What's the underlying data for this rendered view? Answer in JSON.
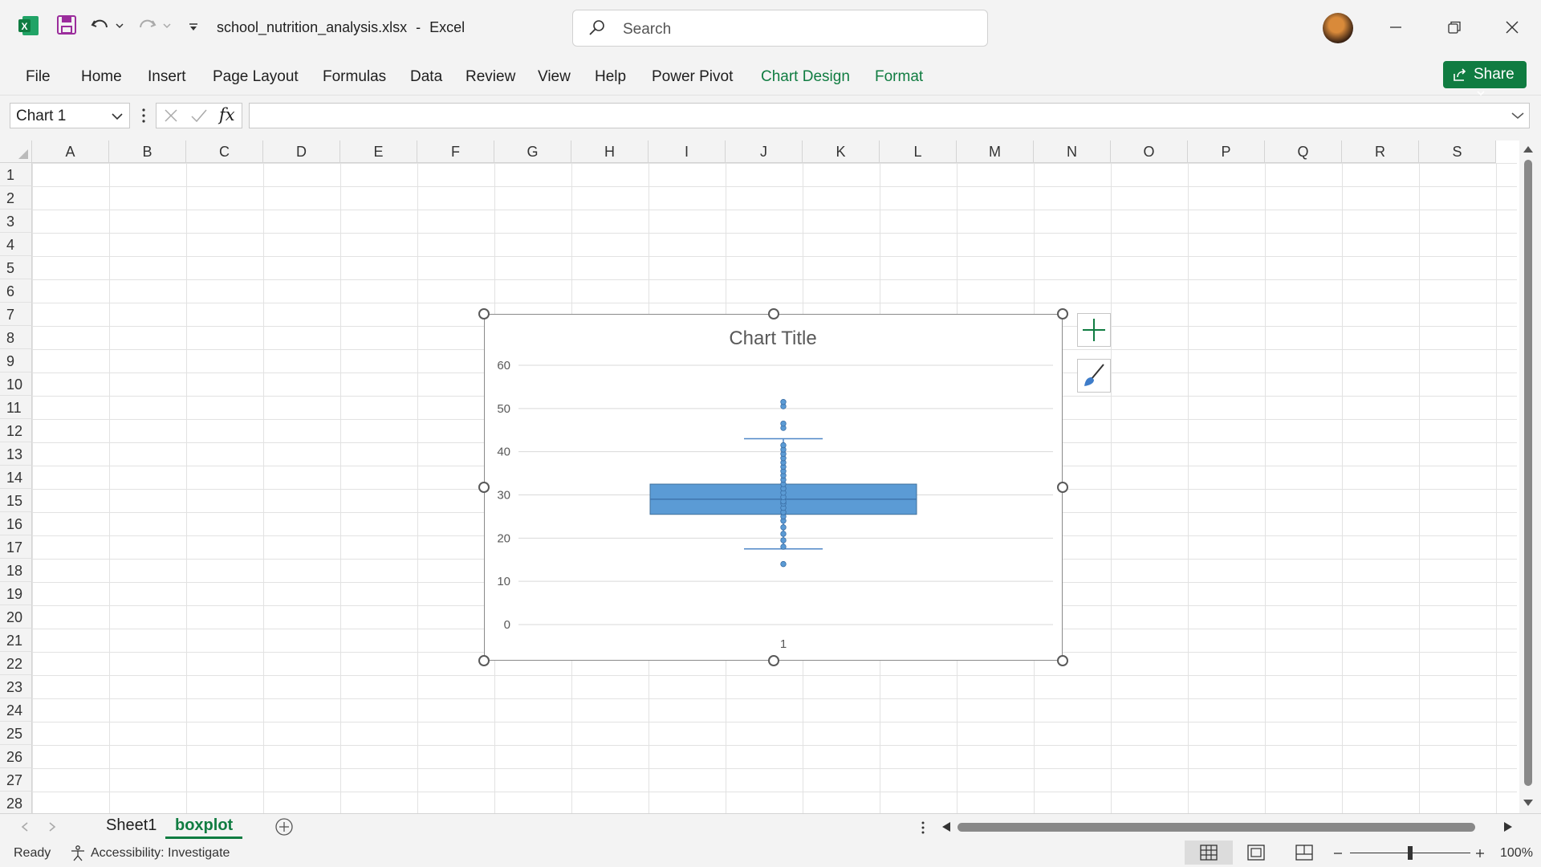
{
  "titlebar": {
    "filename": "school_nutrition_analysis.xlsx",
    "separator": "-",
    "app_name": "Excel",
    "search_placeholder": "Search"
  },
  "ribbon": {
    "tabs": [
      "File",
      "Home",
      "Insert",
      "Page Layout",
      "Formulas",
      "Data",
      "Review",
      "View",
      "Help",
      "Power Pivot"
    ],
    "context_tabs": [
      "Chart Design",
      "Format"
    ],
    "share_label": "Share"
  },
  "formula_bar": {
    "name_box": "Chart 1",
    "fx": "fx",
    "formula": ""
  },
  "grid": {
    "columns": [
      "A",
      "B",
      "C",
      "D",
      "E",
      "F",
      "G",
      "H",
      "I",
      "J",
      "K",
      "L",
      "M",
      "N",
      "O",
      "P",
      "Q",
      "R",
      "S"
    ],
    "rows": [
      "1",
      "2",
      "3",
      "4",
      "5",
      "6",
      "7",
      "8",
      "9",
      "10",
      "11",
      "12",
      "13",
      "14",
      "15",
      "16",
      "17",
      "18",
      "19",
      "20",
      "21",
      "22",
      "23",
      "24",
      "25",
      "26",
      "27",
      "28"
    ]
  },
  "chart_data": {
    "type": "box",
    "title": "Chart Title",
    "categories": [
      "1"
    ],
    "yticks": [
      "0",
      "10",
      "20",
      "30",
      "40",
      "50",
      "60"
    ],
    "ylim": [
      0,
      60
    ],
    "box": {
      "min": 17.5,
      "q1": 25.5,
      "median": 29,
      "q3": 32.5,
      "max": 43
    },
    "points": [
      14,
      18,
      19.5,
      21,
      22.5,
      24,
      25,
      26,
      27,
      28,
      28.5,
      29.5,
      30.5,
      31.5,
      32.5,
      33.5,
      34.5,
      35.5,
      36.5,
      37.5,
      38.5,
      39.5,
      40.5,
      41.5,
      45.5,
      46.5,
      50.5,
      51.5
    ],
    "color": "#5b9bd5"
  },
  "sheets": {
    "tabs": [
      "Sheet1",
      "boxplot"
    ],
    "active": "boxplot"
  },
  "status": {
    "ready": "Ready",
    "accessibility": "Accessibility: Investigate",
    "zoom": "100%"
  }
}
